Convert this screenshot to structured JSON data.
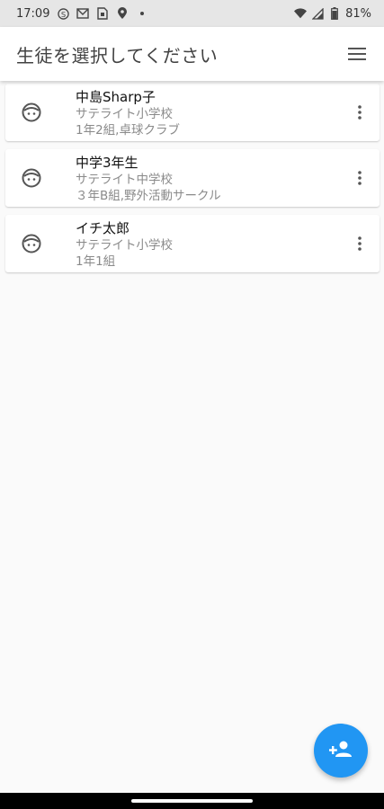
{
  "status_bar": {
    "time": "17:09",
    "battery": "81%",
    "left_icons": [
      "s-circle-icon",
      "m-mail-icon",
      "sim-card-icon",
      "location-icon",
      "dot-icon"
    ],
    "right_icons": [
      "wifi-icon",
      "signal-icon",
      "battery-icon"
    ]
  },
  "app_bar": {
    "title": "生徒を選択してください",
    "menu_icon": "hamburger-menu-icon"
  },
  "students": [
    {
      "name": "中島Sharp子",
      "school": "サテライト小学校",
      "detail": "1年2組,卓球クラブ"
    },
    {
      "name": "中学3年生",
      "school": "サテライト中学校",
      "detail": "３年B組,野外活動サークル"
    },
    {
      "name": "イチ太郎",
      "school": "サテライト小学校",
      "detail": "1年1組"
    }
  ],
  "fab": {
    "icon": "add-person-icon",
    "color": "#2196f3"
  }
}
